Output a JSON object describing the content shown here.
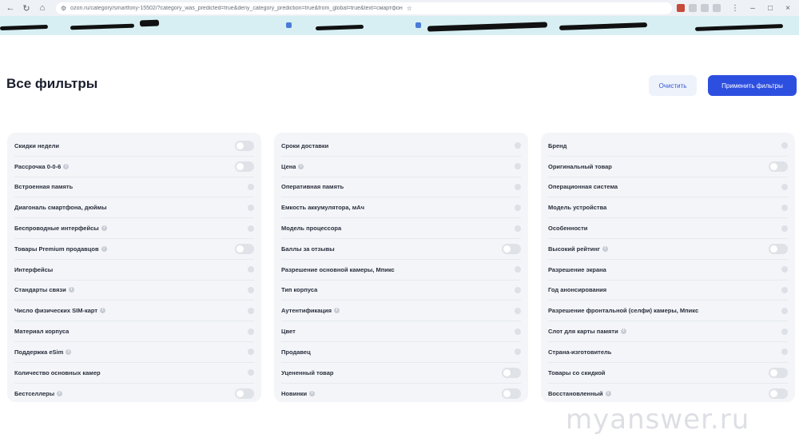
{
  "browser": {
    "url": "ozon.ru/category/smartfony-15502/?category_was_predicted=true&deny_category_prediction=true&from_global=true&text=смартфон"
  },
  "header": {
    "title": "Все фильтры",
    "clear_label": "Очистить",
    "apply_label": "Применить фильтры"
  },
  "columns": [
    {
      "rows": [
        {
          "label": "Скидки недели",
          "control": "toggle",
          "info": false
        },
        {
          "label": "Рассрочка 0-0-6",
          "control": "toggle",
          "info": true
        },
        {
          "label": "Встроенная память",
          "control": "chevron",
          "info": false
        },
        {
          "label": "Диагональ смартфона, дюймы",
          "control": "chevron",
          "info": false
        },
        {
          "label": "Беспроводные интерфейсы",
          "control": "chevron",
          "info": true
        },
        {
          "label": "Товары Premium продавцов",
          "control": "toggle",
          "info": true
        },
        {
          "label": "Интерфейсы",
          "control": "chevron",
          "info": false
        },
        {
          "label": "Стандарты связи",
          "control": "chevron",
          "info": true
        },
        {
          "label": "Число физических SIM-карт",
          "control": "chevron",
          "info": true
        },
        {
          "label": "Материал корпуса",
          "control": "chevron",
          "info": false
        },
        {
          "label": "Поддержка eSim",
          "control": "chevron",
          "info": true
        },
        {
          "label": "Количество основных камер",
          "control": "chevron",
          "info": false
        },
        {
          "label": "Бестселлеры",
          "control": "toggle",
          "info": true
        }
      ]
    },
    {
      "rows": [
        {
          "label": "Сроки доставки",
          "control": "chevron",
          "info": false
        },
        {
          "label": "Цена",
          "control": "chevron",
          "info": true
        },
        {
          "label": "Оперативная память",
          "control": "chevron",
          "info": false
        },
        {
          "label": "Емкость аккумулятора, мАч",
          "control": "chevron",
          "info": false
        },
        {
          "label": "Модель процессора",
          "control": "chevron",
          "info": false
        },
        {
          "label": "Баллы за отзывы",
          "control": "toggle",
          "info": false
        },
        {
          "label": "Разрешение основной камеры, Мпикс",
          "control": "chevron",
          "info": false
        },
        {
          "label": "Тип корпуса",
          "control": "chevron",
          "info": false
        },
        {
          "label": "Аутентификация",
          "control": "chevron",
          "info": true
        },
        {
          "label": "Цвет",
          "control": "chevron",
          "info": false
        },
        {
          "label": "Продавец",
          "control": "chevron",
          "info": false
        },
        {
          "label": "Уцененный товар",
          "control": "toggle",
          "info": false
        },
        {
          "label": "Новинки",
          "control": "toggle",
          "info": true
        }
      ]
    },
    {
      "rows": [
        {
          "label": "Бренд",
          "control": "chevron",
          "info": false
        },
        {
          "label": "Оригинальный товар",
          "control": "toggle",
          "info": false
        },
        {
          "label": "Операционная система",
          "control": "chevron",
          "info": false
        },
        {
          "label": "Модель устройства",
          "control": "chevron",
          "info": false
        },
        {
          "label": "Особенности",
          "control": "chevron",
          "info": false
        },
        {
          "label": "Высокий рейтинг",
          "control": "toggle",
          "info": true
        },
        {
          "label": "Разрешение экрана",
          "control": "chevron",
          "info": false
        },
        {
          "label": "Год анонсирования",
          "control": "chevron",
          "info": false
        },
        {
          "label": "Разрешение фронтальной (селфи) камеры, Мпикс",
          "control": "chevron",
          "info": false
        },
        {
          "label": "Слот для карты памяти",
          "control": "chevron",
          "info": true
        },
        {
          "label": "Страна-изготовитель",
          "control": "chevron",
          "info": false
        },
        {
          "label": "Товары со скидкой",
          "control": "toggle",
          "info": false
        },
        {
          "label": "Восстановленный",
          "control": "toggle",
          "info": true
        }
      ]
    }
  ],
  "watermark": "myanswer.ru"
}
